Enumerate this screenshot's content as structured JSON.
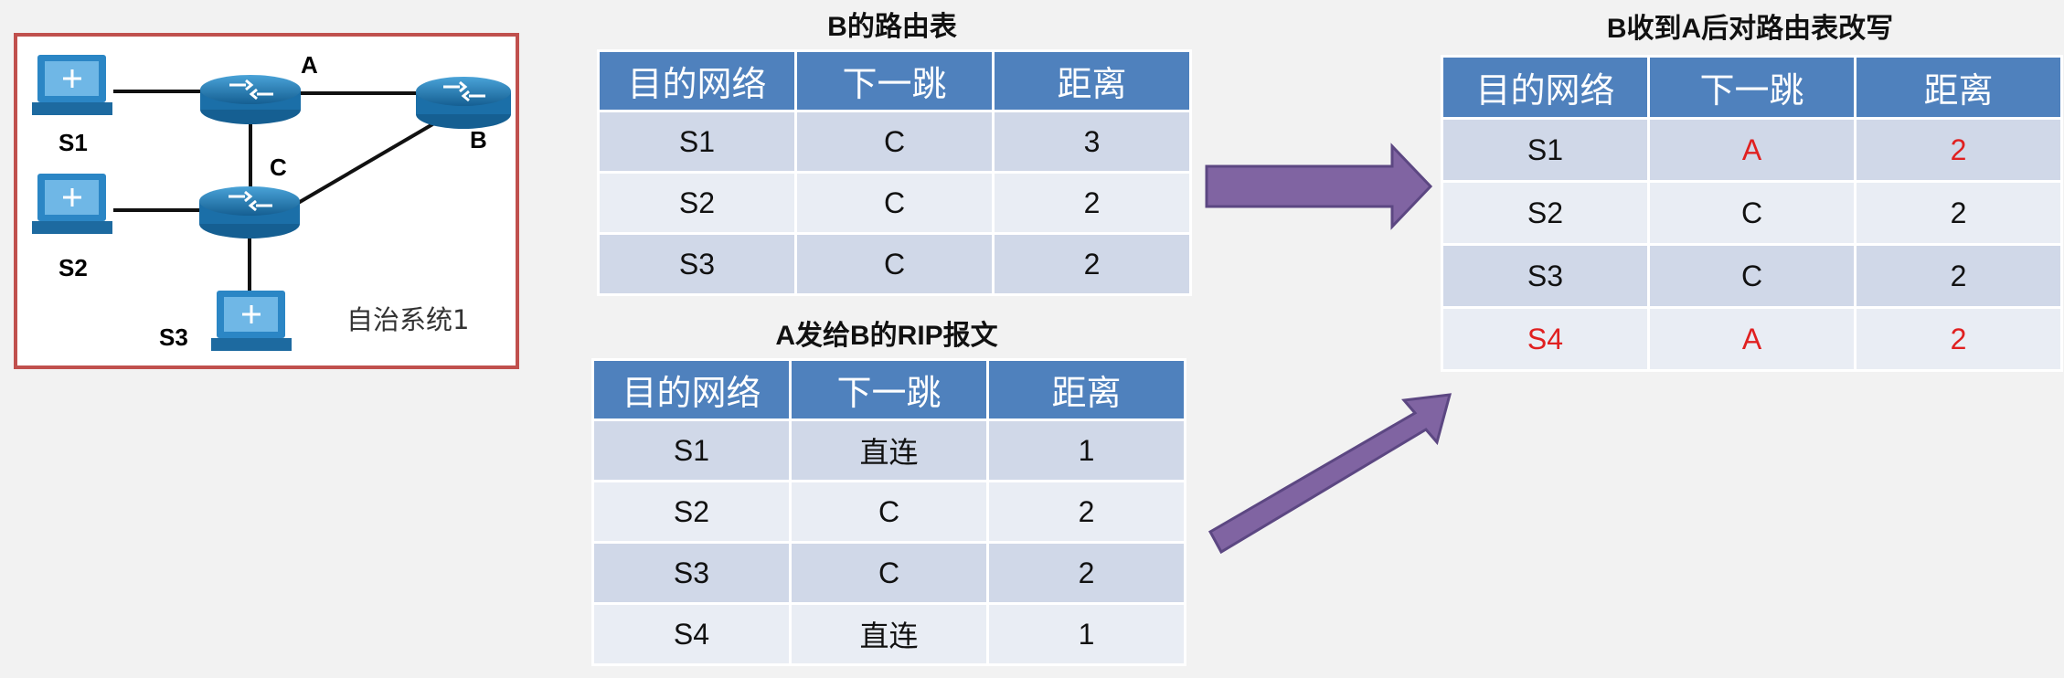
{
  "network": {
    "hosts": {
      "s1": "S1",
      "s2": "S2",
      "s3": "S3"
    },
    "routers": {
      "a": "A",
      "b": "B",
      "c": "C"
    },
    "as_label": "自治系统1",
    "colors": {
      "router": "#1e7bb5",
      "pc": "#2b86c5",
      "border": "#c0504d"
    }
  },
  "table_b": {
    "title": "B的路由表",
    "headers": [
      "目的网络",
      "下一跳",
      "距离"
    ],
    "rows": [
      [
        "S1",
        "C",
        "3"
      ],
      [
        "S2",
        "C",
        "2"
      ],
      [
        "S3",
        "C",
        "2"
      ]
    ]
  },
  "table_msg": {
    "title": "A发给B的RIP报文",
    "headers": [
      "目的网络",
      "下一跳",
      "距离"
    ],
    "rows": [
      [
        "S1",
        "直连",
        "1"
      ],
      [
        "S2",
        "C",
        "2"
      ],
      [
        "S3",
        "C",
        "2"
      ],
      [
        "S4",
        "直连",
        "1"
      ]
    ]
  },
  "table_new": {
    "title": "B收到A后对路由表改写",
    "headers": [
      "目的网络",
      "下一跳",
      "距离"
    ],
    "rows": [
      [
        "S1",
        "A",
        "2"
      ],
      [
        "S2",
        "C",
        "2"
      ],
      [
        "S3",
        "C",
        "2"
      ],
      [
        "S4",
        "A",
        "2"
      ]
    ],
    "highlight_color": "#e02020"
  },
  "arrow_color": "#8064a2"
}
